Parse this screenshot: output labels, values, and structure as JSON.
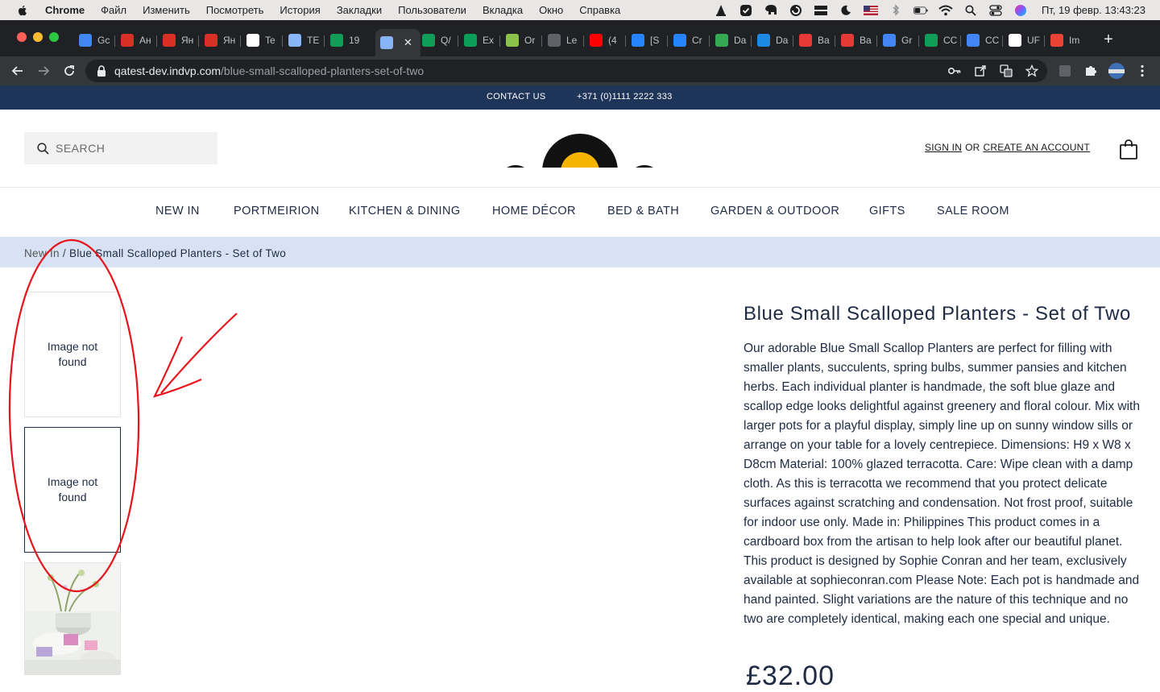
{
  "menubar": {
    "app_name": "Chrome",
    "items": [
      "Файл",
      "Изменить",
      "Посмотреть",
      "История",
      "Закладки",
      "Пользователи",
      "Вкладка",
      "Окно",
      "Справка"
    ],
    "clock": "Пт, 19 февр.  13:43:23"
  },
  "tabs": [
    {
      "label": "Gc",
      "icon": "google-translate-icon",
      "color": "#4285f4"
    },
    {
      "label": "Ан",
      "icon": "assessment-icon",
      "color": "#d93025"
    },
    {
      "label": "Ян",
      "icon": "assessment-icon",
      "color": "#d93025"
    },
    {
      "label": "Ян",
      "icon": "assessment-icon",
      "color": "#d93025"
    },
    {
      "label": "Te",
      "icon": "notion-icon",
      "color": "#ffffff"
    },
    {
      "label": "TE",
      "icon": "shell-icon",
      "color": "#8ab4f8"
    },
    {
      "label": "19",
      "icon": "sheets-icon",
      "color": "#0f9d58"
    },
    {
      "label": "",
      "icon": "shell-icon",
      "color": "#8ab4f8"
    },
    {
      "label": "Q/",
      "icon": "sheets-icon",
      "color": "#0f9d58"
    },
    {
      "label": "Ex",
      "icon": "wix-icon",
      "color": "#0c9d58"
    },
    {
      "label": "Or",
      "icon": "image-icon",
      "color": "#8bc34a"
    },
    {
      "label": "Le",
      "icon": "globe-icon",
      "color": "#5f6368"
    },
    {
      "label": "(4",
      "icon": "youtube-icon",
      "color": "#ff0000"
    },
    {
      "label": "[S",
      "icon": "jira-icon",
      "color": "#2684ff"
    },
    {
      "label": "Cr",
      "icon": "jira-icon",
      "color": "#2684ff"
    },
    {
      "label": "Da",
      "icon": "dashboard-icon",
      "color": "#34a853"
    },
    {
      "label": "Da",
      "icon": "datalens-icon",
      "color": "#1e88e5"
    },
    {
      "label": "Ba",
      "icon": "r-icon",
      "color": "#e53935"
    },
    {
      "label": "Ba",
      "icon": "r-icon",
      "color": "#e53935"
    },
    {
      "label": "Gr",
      "icon": "contacts-icon",
      "color": "#4285f4"
    },
    {
      "label": "CC",
      "icon": "sheets-icon",
      "color": "#0f9d58"
    },
    {
      "label": "CC",
      "icon": "docs-icon",
      "color": "#4285f4"
    },
    {
      "label": "UF",
      "icon": "wikipedia-icon",
      "color": "#ffffff"
    },
    {
      "label": "Im",
      "icon": "image-icon",
      "color": "#ea4335"
    }
  ],
  "omnibox": {
    "host": "qatest-dev.indvp.com",
    "path": "/blue-small-scalloped-planters-set-of-two"
  },
  "topbar": {
    "contact": "CONTACT US",
    "phone": "+371 (0)1111 2222 333"
  },
  "header": {
    "search_placeholder": "SEARCH",
    "sign_in": "SIGN IN",
    "or": "OR",
    "create_account": "CREATE AN ACCOUNT"
  },
  "nav": [
    "NEW IN",
    "PORTMEIRION",
    "KITCHEN & DINING",
    "HOME DÉCOR",
    "BED & BATH",
    "GARDEN & OUTDOOR",
    "GIFTS",
    "SALE ROOM"
  ],
  "breadcrumb": {
    "parent": "New In",
    "separator": "/",
    "current": "Blue Small Scalloped Planters - Set of Two"
  },
  "gallery": {
    "missing_text": "Image not found"
  },
  "product": {
    "title": "Blue Small Scalloped Planters - Set of Two",
    "description": "Our adorable Blue Small Scallop Planters are perfect for filling with smaller plants, succulents, spring bulbs, summer pansies and kitchen herbs. Each individual planter is handmade, the soft blue glaze and scallop edge looks delightful against greenery and floral colour. Mix with larger pots for a playful display, simply line up on sunny window sills or arrange on your table for a lovely centrepiece. Dimensions: H9 x W8 x D8cm Material: 100% glazed terracotta. Care: Wipe clean with a damp cloth. As this is terracotta we recommend that you protect delicate surfaces against scratching and condensation. Not frost proof, suitable for indoor use only. Made in: Philippines This product comes in a cardboard box from the artisan to help look after our beautiful planet. This product is designed by Sophie Conran and her team, exclusively available at sophieconran.com Please Note: Each pot is handmade and hand painted. Slight variations are the nature of this technique and no two are completely identical, making each one special and unique.",
    "price": "£32.00"
  },
  "colors": {
    "navy": "#1f3459",
    "text_navy": "#1f2a44",
    "breadcrumb_bg": "#d7e3f4",
    "annotation_red": "#e8141c"
  }
}
